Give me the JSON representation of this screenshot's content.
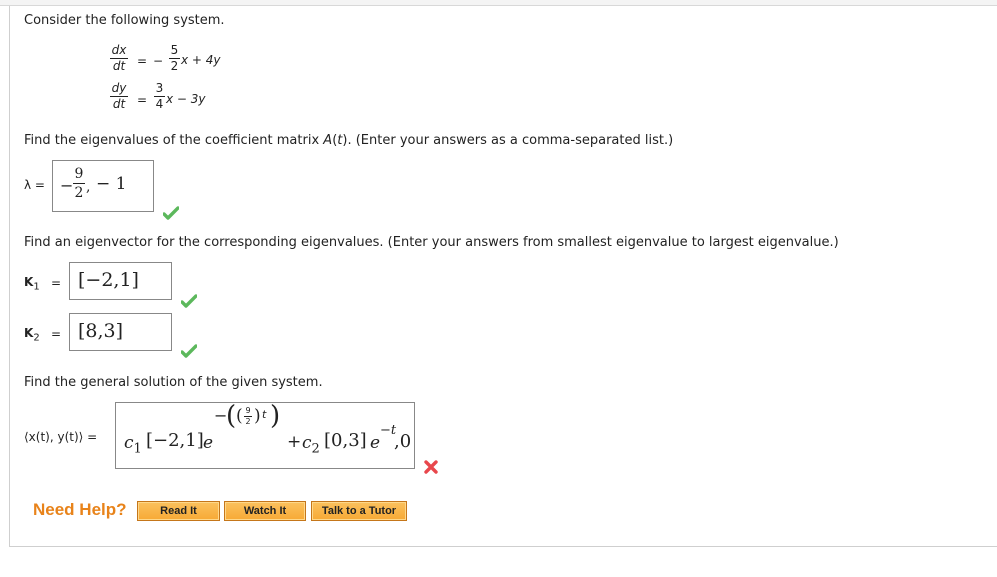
{
  "intro": "Consider the following system.",
  "system": {
    "eq1": {
      "lhs_num": "dx",
      "lhs_den": "dt",
      "eq": "=",
      "sign": "−",
      "coef_num": "5",
      "coef_den": "2",
      "rest": "x + 4y"
    },
    "eq2": {
      "lhs_num": "dy",
      "lhs_den": "dt",
      "eq": "=",
      "coef_num": "3",
      "coef_den": "4",
      "rest": "x − 3y"
    }
  },
  "q1": {
    "prompt_pre": "Find the eigenvalues of the coefficient matrix ",
    "prompt_mat": "A",
    "prompt_t": "t",
    "prompt_post": ". (Enter your answers as a comma-separated list.)",
    "label": "λ =",
    "answer": {
      "minus": "−",
      "num": "9",
      "den": "2",
      "sep": ",",
      "second": "− 1"
    },
    "status": "correct"
  },
  "q2": {
    "prompt": "Find an eigenvector for the corresponding eigenvalues. (Enter your answers from smallest eigenvalue to largest eigenvalue.)",
    "k1": {
      "label": "K",
      "sub": "1",
      "eq": "=",
      "value": "[−2,1]",
      "status": "correct"
    },
    "k2": {
      "label": "K",
      "sub": "2",
      "eq": "=",
      "value": "[8,3]",
      "status": "correct"
    }
  },
  "q3": {
    "prompt": "Find the general solution of the given system.",
    "label": "⟨x(t), y(t)⟩ =",
    "answer": {
      "c1": "c",
      "c1sub": "1",
      "vec1": "[−2,1]",
      "e1": "e",
      "exp1": "−((9/2)t)",
      "exp1_minus": "−",
      "exp1_num": "9",
      "exp1_den": "2",
      "exp1_t": "t",
      "plus": "+",
      "c2": "c",
      "c2sub": "2",
      "vec2": "[0,3]",
      "e2": "e",
      "exp2": "−t",
      "tail": ",0"
    },
    "status": "incorrect"
  },
  "help": {
    "label": "Need Help?",
    "buttons": [
      "Read It",
      "Watch It",
      "Talk to a Tutor"
    ]
  },
  "colors": {
    "accent": "#e8831a",
    "correct": "#5cb85c",
    "incorrect": "#e8474c"
  }
}
